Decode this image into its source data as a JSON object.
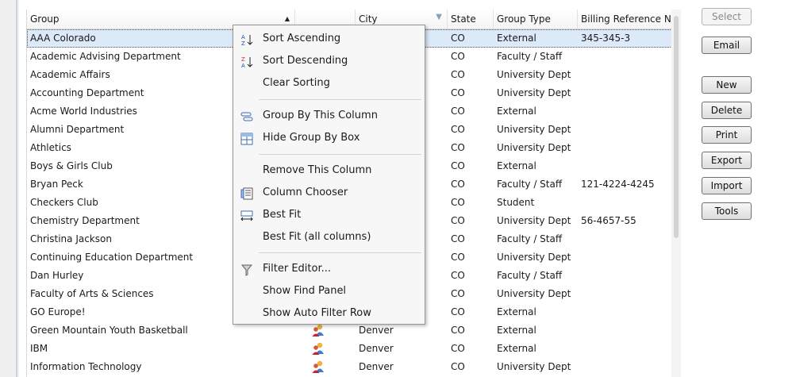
{
  "columns": [
    {
      "label": "Group"
    },
    {
      "label": ""
    },
    {
      "label": "City"
    },
    {
      "label": "State"
    },
    {
      "label": "Group Type"
    },
    {
      "label": "Billing Reference N"
    }
  ],
  "rows": [
    {
      "group": "AAA Colorado",
      "city": "",
      "state": "CO",
      "type": "External",
      "billing": "345-345-3"
    },
    {
      "group": "Academic Advising Department",
      "city": "",
      "state": "CO",
      "type": "Faculty / Staff",
      "billing": ""
    },
    {
      "group": "Academic Affairs",
      "city": "",
      "state": "CO",
      "type": "University Dept",
      "billing": ""
    },
    {
      "group": "Accounting Department",
      "city": "",
      "state": "CO",
      "type": "University Dept",
      "billing": ""
    },
    {
      "group": "Acme World Industries",
      "city": "",
      "state": "CO",
      "type": "External",
      "billing": ""
    },
    {
      "group": "Alumni Department",
      "city": "",
      "state": "CO",
      "type": "University Dept",
      "billing": ""
    },
    {
      "group": "Athletics",
      "city": "",
      "state": "CO",
      "type": "University Dept",
      "billing": ""
    },
    {
      "group": "Boys & Girls Club",
      "city": "",
      "state": "CO",
      "type": "External",
      "billing": ""
    },
    {
      "group": "Bryan Peck",
      "city": "",
      "state": "CO",
      "type": "Faculty / Staff",
      "billing": "121-4224-4245"
    },
    {
      "group": "Checkers Club",
      "city": "",
      "state": "CO",
      "type": "Student",
      "billing": ""
    },
    {
      "group": "Chemistry Department",
      "city": "",
      "state": "CO",
      "type": "University Dept",
      "billing": "56-4657-55"
    },
    {
      "group": "Christina Jackson",
      "city": "",
      "state": "CO",
      "type": "Faculty / Staff",
      "billing": ""
    },
    {
      "group": "Continuing Education Department",
      "city": "",
      "state": "CO",
      "type": "University Dept",
      "billing": ""
    },
    {
      "group": "Dan Hurley",
      "city": "",
      "state": "CO",
      "type": "Faculty / Staff",
      "billing": ""
    },
    {
      "group": "Faculty of Arts & Sciences",
      "city": "",
      "state": "CO",
      "type": "University Dept",
      "billing": ""
    },
    {
      "group": "GO Europe!",
      "city": "",
      "state": "CO",
      "type": "External",
      "billing": ""
    },
    {
      "group": "Green Mountain Youth Basketball",
      "city": "Denver",
      "state": "CO",
      "type": "External",
      "billing": ""
    },
    {
      "group": "IBM",
      "city": "Denver",
      "state": "CO",
      "type": "External",
      "billing": ""
    },
    {
      "group": "Information Technology",
      "city": "Denver",
      "state": "CO",
      "type": "University Dept",
      "billing": ""
    }
  ],
  "buttons": [
    "Select",
    "Email",
    "New",
    "Delete",
    "Print",
    "Export",
    "Import",
    "Tools"
  ],
  "menu": [
    {
      "label": "Sort Ascending",
      "icon": "sort-ascending-icon"
    },
    {
      "label": "Sort Descending",
      "icon": "sort-descending-icon"
    },
    {
      "label": "Clear Sorting",
      "icon": ""
    },
    {
      "label": "Group By This Column",
      "icon": "group-by-icon"
    },
    {
      "label": "Hide Group By Box",
      "icon": "group-box-icon"
    },
    {
      "label": "Remove This Column",
      "icon": ""
    },
    {
      "label": "Column Chooser",
      "icon": "column-chooser-icon"
    },
    {
      "label": "Best Fit",
      "icon": "best-fit-icon"
    },
    {
      "label": "Best Fit (all columns)",
      "icon": ""
    },
    {
      "label": "Filter Editor...",
      "icon": "filter-icon"
    },
    {
      "label": "Show Find Panel",
      "icon": ""
    },
    {
      "label": "Show Auto Filter Row",
      "icon": ""
    }
  ],
  "colors": {
    "selected_row": "#dce9f8",
    "menu_bg": "#f7f7f7"
  }
}
